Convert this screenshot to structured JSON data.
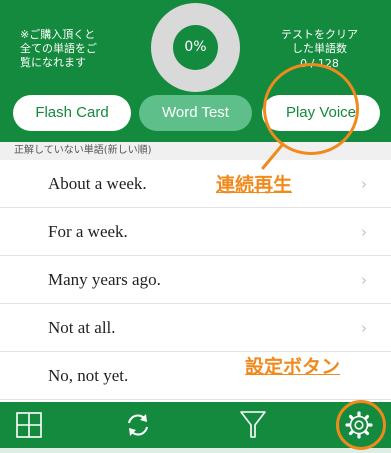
{
  "header": {
    "note_left": "※ご購入頂くと\n全ての単語をご\n覧になれます",
    "progress_percent": "0%",
    "progress_value": 0,
    "note_right": "テストをクリア\nした単語数",
    "count": "0 / 128",
    "colors": {
      "primary": "#138a3e",
      "ring": "#d9d9d9",
      "accent_tab": "#5fbf8a",
      "annotation": "#f08a1c"
    }
  },
  "tabs": [
    {
      "label": "Flash Card"
    },
    {
      "label": "Word Test",
      "selected": true
    },
    {
      "label": "Play Voice"
    }
  ],
  "section": {
    "title": "正解していない単語(新しい順)"
  },
  "list": [
    {
      "text": "About a week.",
      "chevron": "›"
    },
    {
      "text": "For a week.",
      "chevron": "›"
    },
    {
      "text": "Many years ago.",
      "chevron": "›"
    },
    {
      "text": "Not at all.",
      "chevron": "›"
    },
    {
      "text": "No, not yet.",
      "chevron": "›"
    }
  ],
  "toolbar": {
    "buttons": [
      {
        "icon": "grid-icon"
      },
      {
        "icon": "refresh-icon"
      },
      {
        "icon": "filter-icon"
      },
      {
        "icon": "gear-icon"
      }
    ]
  },
  "annotations": {
    "continuous_play": "連続再生",
    "settings_button": "設定ボタン"
  }
}
